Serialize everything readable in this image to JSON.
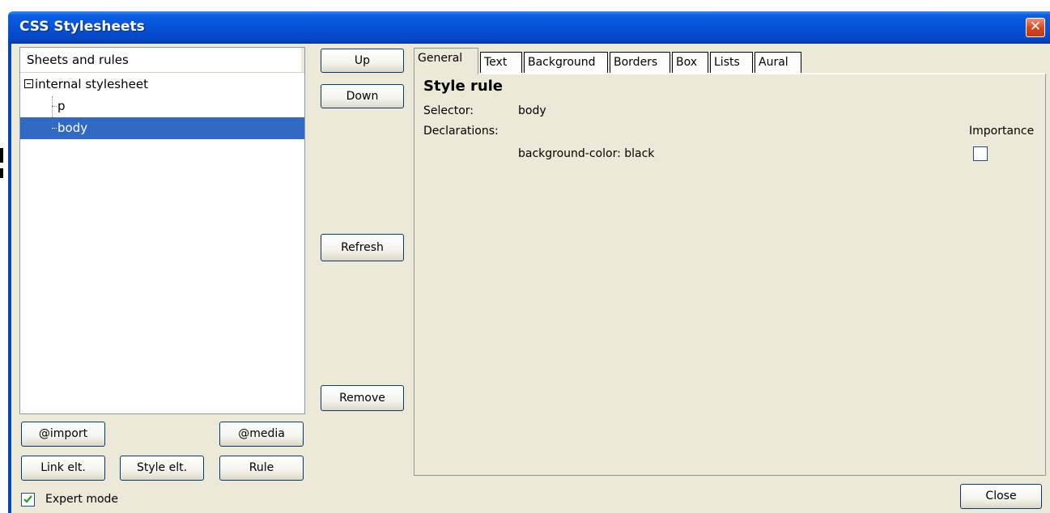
{
  "window": {
    "title": "CSS Stylesheets",
    "close_glyph": "✕"
  },
  "sheets": {
    "header": "Sheets and rules",
    "root": "internal stylesheet",
    "children": [
      "p",
      "body"
    ]
  },
  "side_buttons": {
    "up": "Up",
    "down": "Down",
    "refresh": "Refresh",
    "remove": "Remove"
  },
  "bottom_buttons": {
    "import": "@import",
    "media": "@media",
    "link": "Link elt.",
    "style": "Style elt.",
    "rule": "Rule"
  },
  "expert_mode": {
    "label": "Expert mode",
    "checked": true
  },
  "tabs": [
    "General",
    "Text",
    "Background",
    "Borders",
    "Box",
    "Lists",
    "Aural"
  ],
  "rule": {
    "heading": "Style rule",
    "selector_label": "Selector:",
    "selector_value": "body",
    "declarations_label": "Declarations:",
    "importance_label": "Importance",
    "declaration": "background-color: black"
  },
  "close_button": "Close",
  "colors": {
    "titlebar": "#0552d6",
    "selection": "#316ac5",
    "dialog_bg": "#ece9d8"
  }
}
